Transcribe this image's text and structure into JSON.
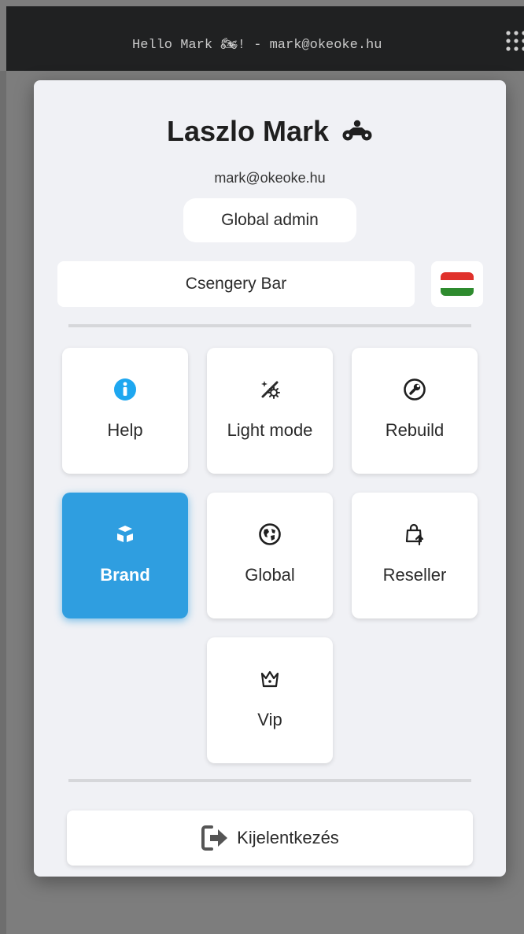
{
  "topbar": {
    "greeting": "Hello Mark 🏍! - mark@okeoke.hu",
    "apps_icon": "grid-dots-icon"
  },
  "profile": {
    "name": "Laszlo Mark",
    "name_icon": "motorcycle-icon",
    "email": "mark@okeoke.hu",
    "role": "Global admin"
  },
  "venue": {
    "name": "Csengery Bar",
    "language_flag": "hungarian-flag-icon"
  },
  "tiles": [
    {
      "label": "Help",
      "icon": "info-circle-icon",
      "active": false
    },
    {
      "label": "Light mode",
      "icon": "light-mode-icon",
      "active": false
    },
    {
      "label": "Rebuild",
      "icon": "wrench-icon",
      "active": false
    },
    {
      "label": "Brand",
      "icon": "brand-icon",
      "active": true
    },
    {
      "label": "Global",
      "icon": "globe-icon",
      "active": false
    },
    {
      "label": "Reseller",
      "icon": "bag-upload-icon",
      "active": false
    },
    {
      "label": "Vip",
      "icon": "crown-icon",
      "active": false
    }
  ],
  "logout": {
    "label": "Kijelentkezés",
    "icon": "logout-icon"
  },
  "colors": {
    "accent": "#2f9ee0",
    "info_icon": "#1ea7f0",
    "panel_bg": "#f0f1f5",
    "topbar_bg": "#202122"
  }
}
